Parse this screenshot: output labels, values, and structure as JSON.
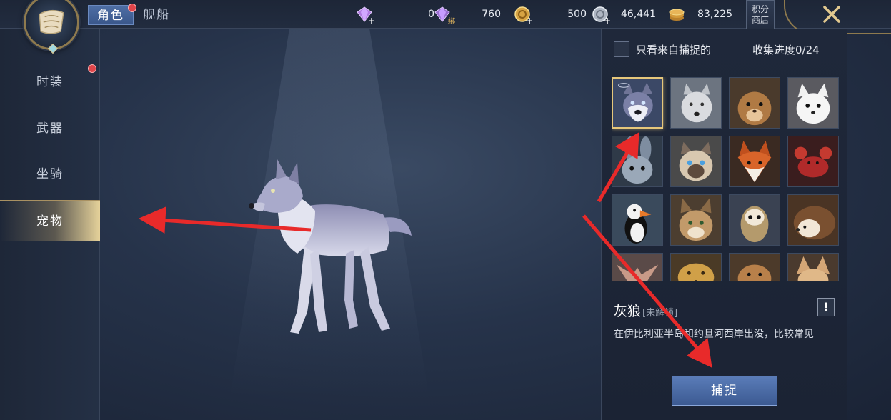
{
  "topbar": {
    "tabs": [
      {
        "label": "角色",
        "active": true
      },
      {
        "label": "舰船",
        "active": false
      }
    ],
    "currencies": [
      {
        "icon": "purple-diamond-icon",
        "value": "0",
        "addable": true
      },
      {
        "icon": "bound-diamond-icon",
        "badge": "绑",
        "value": "760",
        "addable": false
      },
      {
        "icon": "gold-coin-icon",
        "value": "500",
        "addable": true
      },
      {
        "icon": "silver-coin-icon",
        "value": "46,441",
        "addable": true
      },
      {
        "icon": "coin-stack-icon",
        "value": "83,225",
        "addable": false
      }
    ],
    "shop_label_line1": "积分",
    "shop_label_line2": "商店",
    "close_icon": "close-icon"
  },
  "sidebar": {
    "items": [
      {
        "label": "时装",
        "active": false,
        "notify": true
      },
      {
        "label": "武器",
        "active": false,
        "notify": false
      },
      {
        "label": "坐骑",
        "active": false,
        "notify": false
      },
      {
        "label": "宠物",
        "active": true,
        "notify": false
      }
    ]
  },
  "collection": {
    "filter_label": "只看来自捕捉的",
    "filter_checked": false,
    "progress": "收集进度0/24",
    "pets": [
      {
        "icon": "husky-icon",
        "selected": true
      },
      {
        "icon": "white-wolf-icon"
      },
      {
        "icon": "marmot-icon"
      },
      {
        "icon": "white-fox-icon"
      },
      {
        "icon": "rabbit-icon"
      },
      {
        "icon": "cat-icon"
      },
      {
        "icon": "red-fox-icon"
      },
      {
        "icon": "crab-icon"
      },
      {
        "icon": "puffin-icon"
      },
      {
        "icon": "lynx-icon"
      },
      {
        "icon": "owl-icon"
      },
      {
        "icon": "hedgehog-icon"
      },
      {
        "icon": "bat-icon"
      },
      {
        "icon": "leopard-icon"
      },
      {
        "icon": "hamster-icon"
      },
      {
        "icon": "fennec-icon"
      }
    ]
  },
  "detail": {
    "name": "灰狼",
    "state": "[未解锁]",
    "info_icon": "!",
    "description": "在伊比利亚半岛和约旦河西岸出没，比较常见",
    "capture_label": "捕捉"
  },
  "colors": {
    "accent_gold": "#e6c77b",
    "button_blue": "#4a6aa4",
    "notify_red": "#e0454a",
    "annotation_arrow": "#e82a2a"
  }
}
